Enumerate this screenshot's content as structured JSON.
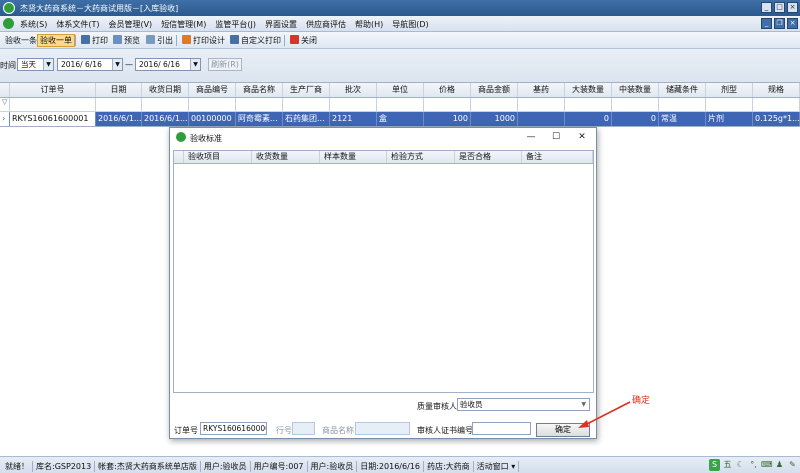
{
  "window": {
    "title": "杰贤大药商系统－大药商试用版－[入库验收]"
  },
  "menu": [
    "系统(S)",
    "体系文件(T)",
    "会员管理(V)",
    "短信管理(M)",
    "监管平台(J)",
    "界面设置",
    "供应商评估",
    "帮助(H)",
    "导航图(D)"
  ],
  "toolbar": {
    "items": [
      {
        "label": "验收一条",
        "icon": "single-check-icon",
        "active": false
      },
      {
        "label": "验收一单",
        "icon": "order-check-icon",
        "active": true
      },
      {
        "label": "打印",
        "icon": "printer-icon",
        "active": false
      },
      {
        "label": "预览",
        "icon": "preview-icon",
        "active": false
      },
      {
        "label": "引出",
        "icon": "export-icon",
        "active": false
      },
      {
        "label": "打印设计",
        "icon": "print-design-icon",
        "active": false
      },
      {
        "label": "自定义打印",
        "icon": "custom-print-icon",
        "active": false
      },
      {
        "label": "关闭",
        "icon": "close-icon",
        "active": false
      }
    ]
  },
  "filter": {
    "time_label": "时间",
    "period": "当天",
    "date_from": "2016/ 6/16",
    "separator": "—",
    "date_to": "2016/ 6/16",
    "refresh_label": "刷新(R)"
  },
  "grid": {
    "columns": [
      "订单号",
      "日期",
      "收货日期",
      "商品编号",
      "商品名称",
      "生产厂商",
      "批次",
      "单位",
      "价格",
      "商品金额",
      "基药",
      "大装数量",
      "中装数量",
      "储藏条件",
      "剂型",
      "规格"
    ],
    "row": [
      "RKYS16061600001",
      "2016/6/1...",
      "2016/6/1...",
      "00100000",
      "阿奇霉素...",
      "石药集团...",
      "2121",
      "盒",
      "100",
      "1000",
      "",
      "0",
      "0",
      "常温",
      "片剂",
      "0.125g*1..."
    ]
  },
  "dialog": {
    "title": "验收标准",
    "columns": [
      "验收项目",
      "收货数量",
      "样本数量",
      "检验方式",
      "是否合格",
      "备注"
    ],
    "quality_reviewer_label": "质量审核人",
    "quality_reviewer_value": "验收员",
    "order_no_label": "订单号",
    "order_no_value": "RKYS1606160000:",
    "line_no_label": "行号",
    "product_name_label": "商品名称",
    "reviewer_cert_label": "审核人证书编号",
    "ok_label": "确定"
  },
  "annotation": {
    "text": "确定",
    "color": "#e0301e"
  },
  "status": [
    "就绪！",
    "库名:GSP2013",
    "帐套:杰贤大药商系统单店版",
    "用户:验收员",
    "用户编号:007",
    "用户:验收员",
    "日期:2016/6/16",
    "药店:大药商",
    "活动窗口 ▾"
  ],
  "colors": {
    "selected_row": "#3f66b5",
    "title_bar": "#3f6fa6",
    "active_tool": "#ffd98a"
  }
}
